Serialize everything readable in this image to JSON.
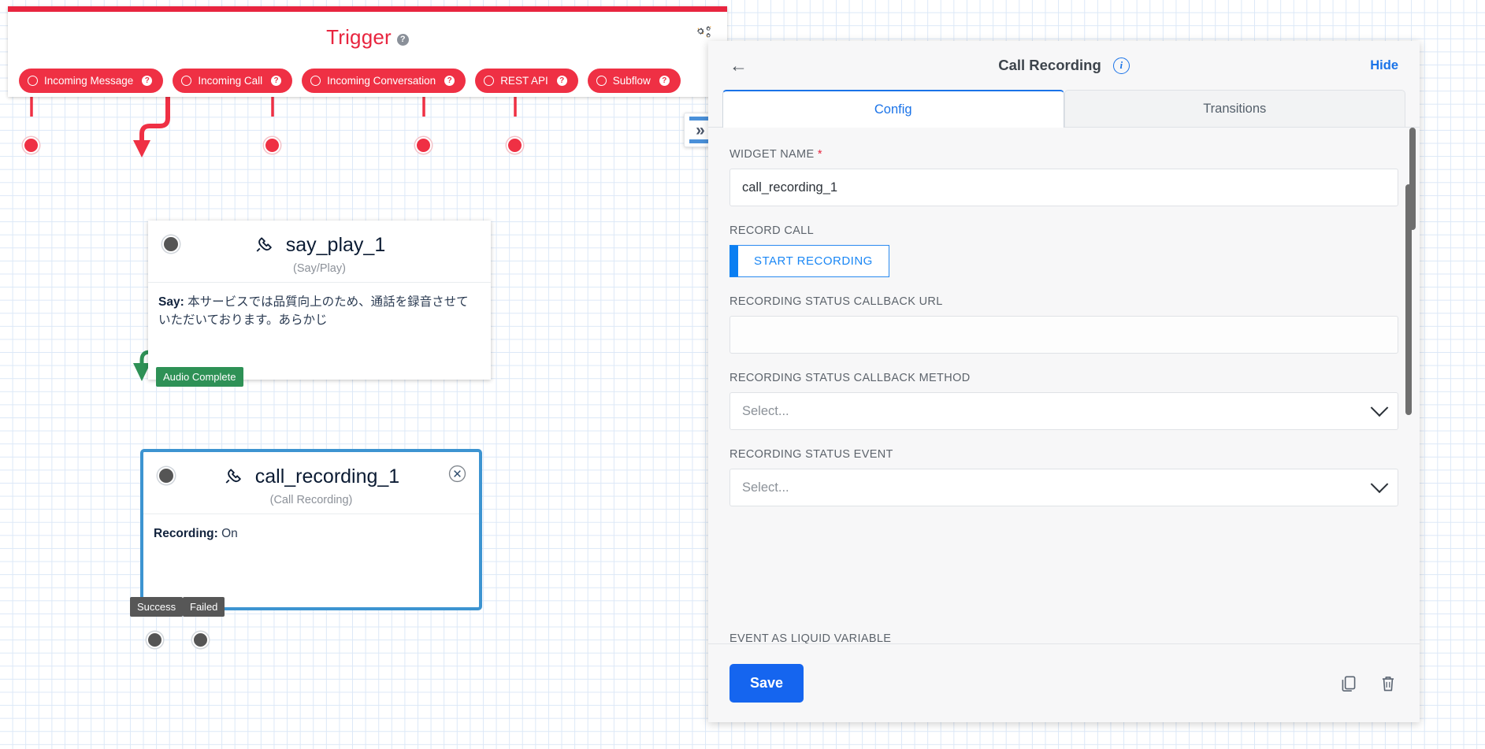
{
  "trigger": {
    "title": "Trigger",
    "help": "?",
    "gear_icon": "gears-icon",
    "pills": [
      {
        "label": "Incoming Message",
        "help": "?"
      },
      {
        "label": "Incoming Call",
        "help": "?"
      },
      {
        "label": "Incoming Conversation",
        "help": "?"
      },
      {
        "label": "REST API",
        "help": "?"
      },
      {
        "label": "Subflow",
        "help": "?"
      }
    ]
  },
  "canvas": {
    "collapse_toggle_label": "»",
    "nodes": [
      {
        "name": "say_play_1",
        "type": "(Say/Play)",
        "body_prefix": "Say:",
        "body_text": "本サービスでは品質向上のため、通話を録音させていただいております。あらかじ",
        "icon": "phone-handset-icon"
      },
      {
        "name": "call_recording_1",
        "type": "(Call Recording)",
        "body_prefix": "Recording:",
        "body_text": "On",
        "icon": "phone-handset-icon"
      }
    ],
    "transitions": [
      {
        "label": "Audio Complete",
        "color": "#2e9156"
      },
      {
        "label": "Success",
        "color": "#575757"
      },
      {
        "label": "Failed",
        "color": "#575757"
      }
    ]
  },
  "panel": {
    "back_icon": "back-arrow-icon",
    "title": "Call Recording",
    "info_icon": "info-icon",
    "hide_label": "Hide",
    "tabs": [
      {
        "label": "Config",
        "active": true
      },
      {
        "label": "Transitions",
        "active": false
      }
    ],
    "fields": [
      {
        "key": "widget_name",
        "label": "WIDGET NAME",
        "required": true,
        "value": "call_recording_1",
        "placeholder": ""
      },
      {
        "key": "record_call",
        "label": "RECORD CALL",
        "required": false,
        "button_label": "START RECORDING"
      },
      {
        "key": "callback_url",
        "label": "RECORDING STATUS CALLBACK URL",
        "required": false,
        "value": "",
        "placeholder": ""
      },
      {
        "key": "callback_method",
        "label": "RECORDING STATUS CALLBACK METHOD",
        "required": false,
        "value": "Select..."
      },
      {
        "key": "status_event",
        "label": "RECORDING STATUS EVENT",
        "required": false,
        "value": "Select..."
      },
      {
        "key": "liquid_variable",
        "label": "EVENT AS LIQUID VARIABLE",
        "required": false
      }
    ],
    "footer": {
      "save_label": "Save",
      "copy_icon": "copy-icon",
      "delete_icon": "trash-icon"
    }
  },
  "colors": {
    "trigger_red": "#ef3044",
    "accent_blue": "#1a73e8",
    "selected_blue": "#3d94d1",
    "green": "#2e9156",
    "save_blue": "#1565ef"
  }
}
